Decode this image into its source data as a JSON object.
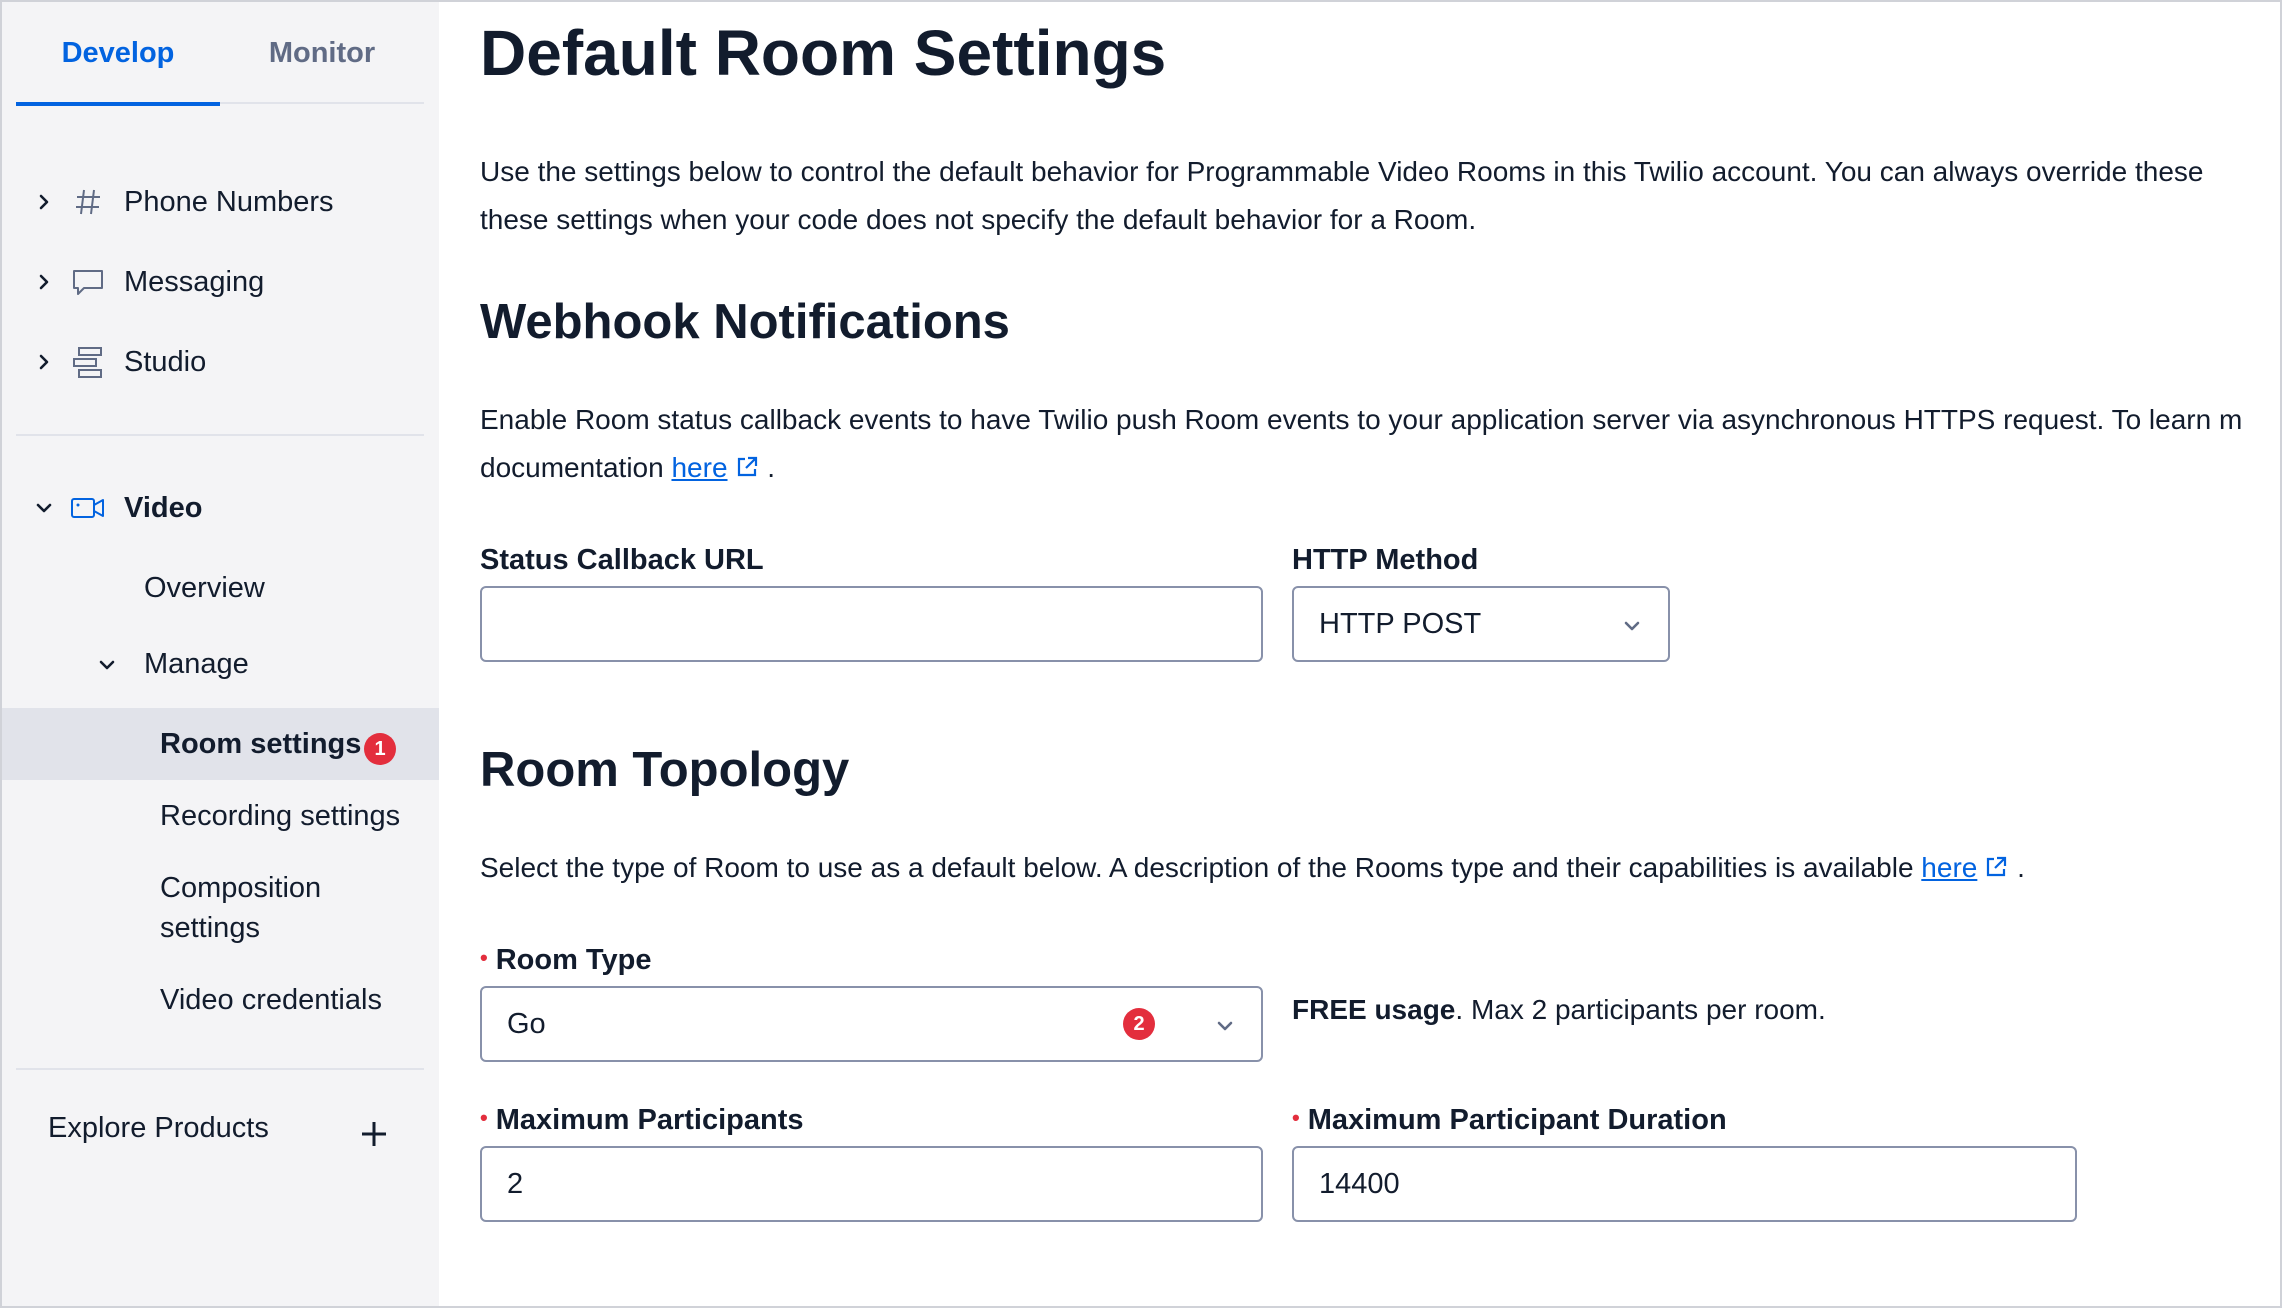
{
  "sidebar": {
    "tabs": [
      {
        "label": "Develop",
        "active": true
      },
      {
        "label": "Monitor",
        "active": false
      }
    ],
    "nav": {
      "phone_numbers": "Phone Numbers",
      "messaging": "Messaging",
      "studio": "Studio",
      "video": "Video"
    },
    "video_sub": {
      "overview": "Overview",
      "manage": "Manage",
      "room_settings": "Room settings",
      "room_settings_badge": "1",
      "recording_settings": "Recording settings",
      "composition_settings_line1": "Composition",
      "composition_settings_line2": "settings",
      "video_credentials": "Video credentials"
    },
    "explore_products": "Explore Products",
    "icons": {
      "phone_numbers": "hash-icon",
      "messaging": "chat-bubble-icon",
      "studio": "flow-icon",
      "video": "video-camera-icon",
      "explore": "plus-icon"
    }
  },
  "main": {
    "title": "Default Room Settings",
    "intro_line1": "Use the settings below to control the default behavior for Programmable Video Rooms in this Twilio account. You can always override these",
    "intro_line2": "these settings when your code does not specify the default behavior for a Room.",
    "webhook": {
      "heading": "Webhook Notifications",
      "desc_line1": "Enable Room status callback events to have Twilio push Room events to your application server via asynchronous HTTPS request. To learn m",
      "desc_line2_prefix": "documentation",
      "desc_link": "here",
      "desc_suffix": ".",
      "status_callback_label": "Status Callback URL",
      "status_callback_value": "",
      "http_method_label": "HTTP Method",
      "http_method_value": "HTTP POST"
    },
    "topology": {
      "heading": "Room Topology",
      "desc_prefix": "Select the type of Room to use as a default below. A description of the Rooms type and their capabilities is available",
      "desc_link": "here",
      "desc_suffix": ".",
      "room_type_label": "Room Type",
      "room_type_value": "Go",
      "room_type_badge": "2",
      "room_type_note_bold": "FREE usage",
      "room_type_note_rest": ". Max 2 participants per room.",
      "max_participants_label": "Maximum Participants",
      "max_participants_value": "2",
      "max_duration_label": "Maximum Participant Duration",
      "max_duration_value": "14400"
    }
  },
  "colors": {
    "accent": "#0263e0",
    "badge": "#e32e3d",
    "sidebar_bg": "#f4f4f6",
    "active_row_bg": "#e1e3ea",
    "text": "#121c2d"
  }
}
